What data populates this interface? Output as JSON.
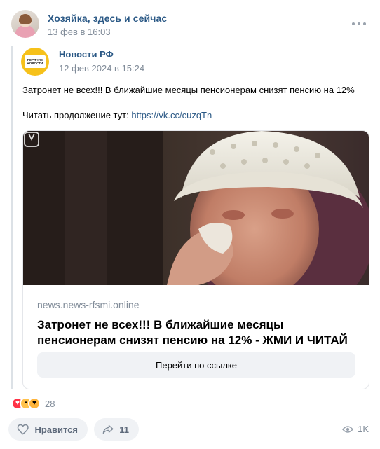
{
  "post": {
    "author": "Хозяйка, здесь и сейчас",
    "time": "13 фев в 16:03",
    "more_icon": "more-horizontal-icon"
  },
  "repost": {
    "source_name": "Новости РФ",
    "source_time": "12 фев 2024 в 15:24",
    "source_logo_line1": "ГОРЯЧИЕ",
    "source_logo_line2": "НОВОСТИ",
    "text_line1": "Затронет не всех!!! В ближайшие месяцы пенсионерам снизят пенсию на 12%",
    "text_line2_prefix": "Читать продолжение тут: ",
    "text_link": "https://vk.cc/cuzqTn"
  },
  "snippet": {
    "domain": "news.news-rfsmi.online",
    "title": "Затронет не всех!!! В ближайшие месяцы пенсионерам снизят пенсию на 12% - ЖМИ И ЧИТАЙ",
    "button": "Перейти по ссылке",
    "image_icon": "video-badge-icon"
  },
  "reactions": {
    "icons": [
      "heart-reaction-icon",
      "wow-reaction-icon",
      "love-eyes-reaction-icon"
    ],
    "count": "28"
  },
  "actions": {
    "like_label": "Нравится",
    "share_count": "11",
    "views": "1K"
  },
  "colors": {
    "link": "#2a5885",
    "secondary": "#818c99",
    "action_bg": "#f0f2f5"
  }
}
